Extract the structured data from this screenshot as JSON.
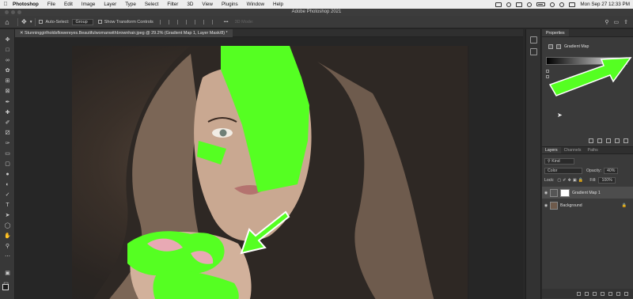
{
  "menubar": {
    "app_name": "Photoshop",
    "items": [
      "File",
      "Edit",
      "Image",
      "Layer",
      "Type",
      "Select",
      "Filter",
      "3D",
      "View",
      "Plugins",
      "Window",
      "Help"
    ],
    "clock": "Mon Sep 27  12:33 PM"
  },
  "titlebar": {
    "title": "Adobe Photoshop 2021"
  },
  "options": {
    "auto_select_label": "Auto-Select:",
    "auto_select_value": "Group",
    "transform_controls_label": "Show Transform Controls",
    "mode_3d_label": "3D Mode:",
    "more_label": "•••"
  },
  "document": {
    "tab_title": "Stunninggirlholdsflowereyes.Beautifulwomanwithbrownhair.jpeg @ 29.2% (Gradient Map 1, Layer Mask/8) *"
  },
  "colors": {
    "highlight": "#55ff22",
    "panel_bg": "#3a3a3a",
    "canvas_bg": "#262626"
  },
  "properties": {
    "tab_label": "Properties",
    "adjustment_title": "Gradient Map"
  },
  "layers_panel": {
    "tabs": [
      "Layers",
      "Channels",
      "Paths"
    ],
    "kind_filter": "Kind",
    "blend_mode": "Color",
    "opacity_label": "Opacity:",
    "opacity_value": "40%",
    "lock_label": "Lock:",
    "fill_label": "Fill:",
    "fill_value": "100%",
    "layers": [
      {
        "name": "Gradient Map 1",
        "selected": true
      },
      {
        "name": "Background",
        "selected": false
      }
    ]
  }
}
